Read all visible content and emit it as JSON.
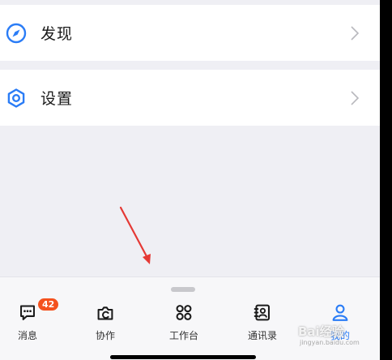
{
  "menu": {
    "discover_label": "发现",
    "settings_label": "设置"
  },
  "tabs": [
    {
      "label": "消息",
      "icon": "message-icon",
      "badge": "42"
    },
    {
      "label": "协作",
      "icon": "collaboration-icon"
    },
    {
      "label": "工作台",
      "icon": "workbench-icon"
    },
    {
      "label": "通讯录",
      "icon": "contacts-icon"
    },
    {
      "label": "我的",
      "icon": "user-icon",
      "active": true
    }
  ],
  "watermark": {
    "text": "Bai经验",
    "sub": "jingyan.baidu.com"
  },
  "colors": {
    "accent": "#2a7cf6",
    "badge": "#f4511e",
    "annotation_arrow": "#e53935"
  }
}
